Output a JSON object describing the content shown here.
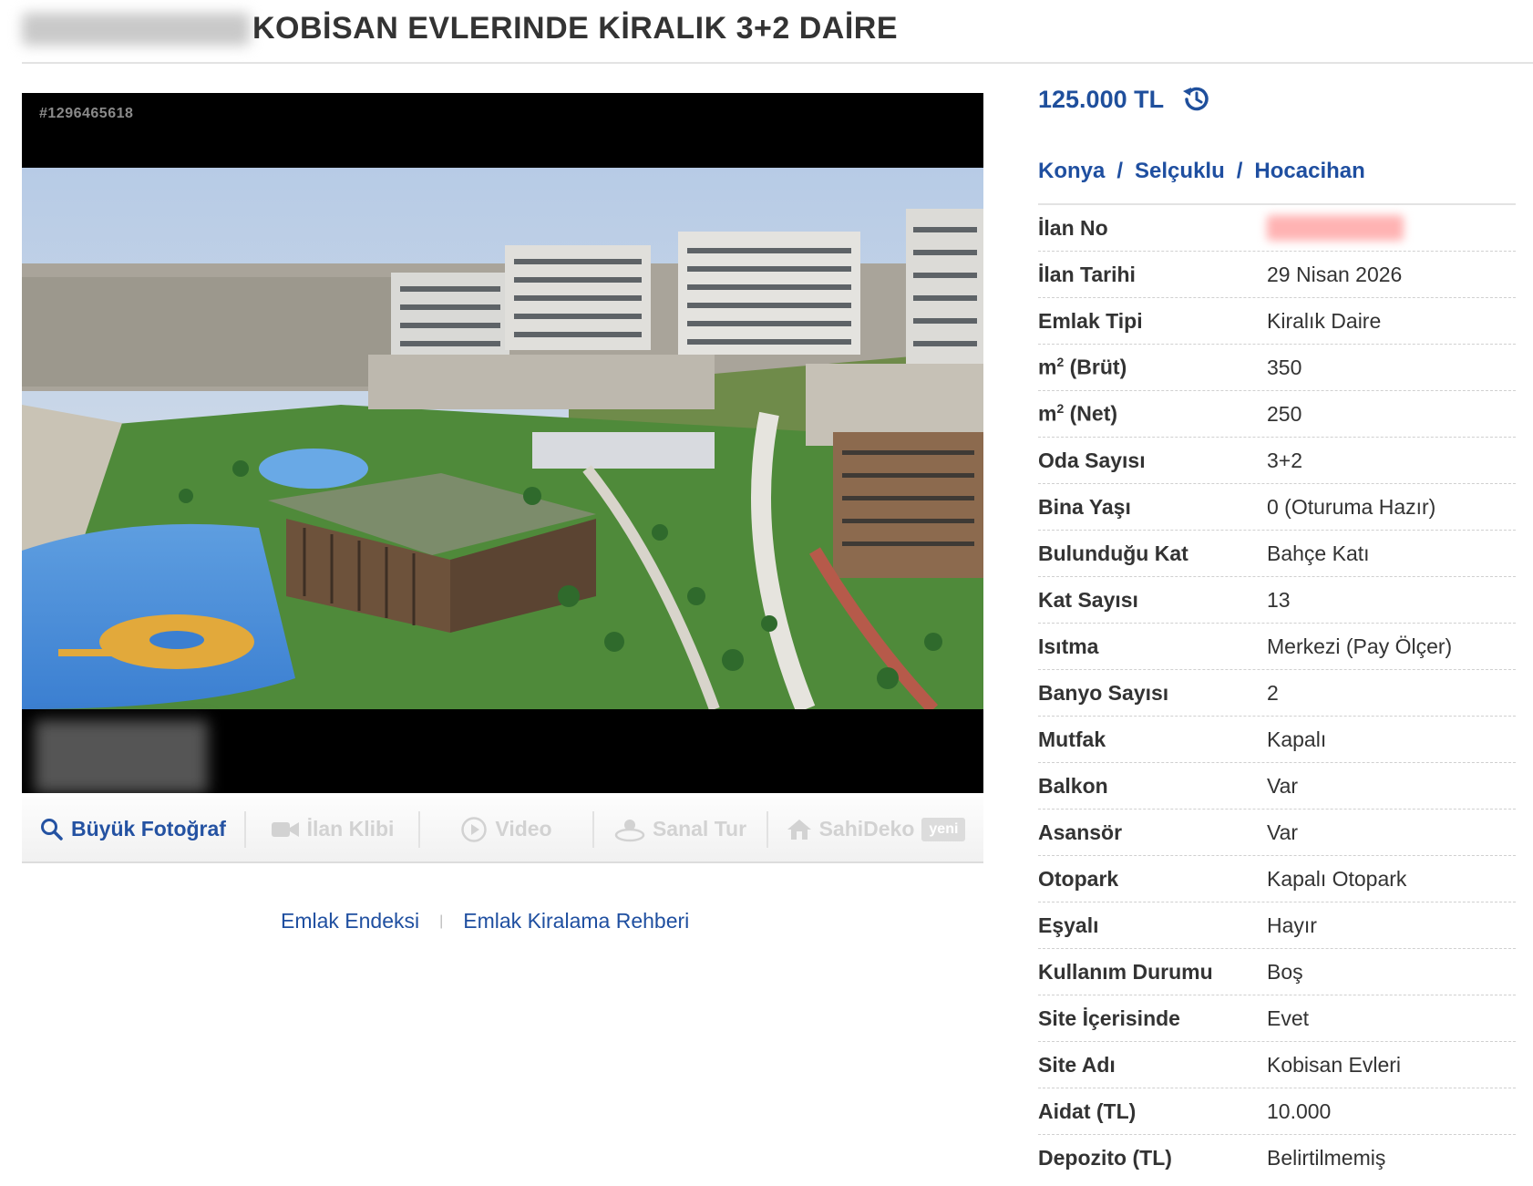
{
  "header": {
    "title": "KOBİSAN EVLERINDE KİRALIK 3+2 DAİRE"
  },
  "photo": {
    "id_overlay": "#1296465618"
  },
  "photo_tabs": [
    {
      "label": "Büyük Fotoğraf",
      "icon": "search-icon",
      "active": true
    },
    {
      "label": "İlan Klibi",
      "icon": "video-camera-icon",
      "active": false
    },
    {
      "label": "Video",
      "icon": "play-circle-icon",
      "active": false
    },
    {
      "label": "Sanal Tur",
      "icon": "360-view-icon",
      "active": false
    },
    {
      "label": "SahiDeko",
      "icon": "home-icon",
      "active": false,
      "badge": "yeni"
    }
  ],
  "links": {
    "index": "Emlak Endeksi",
    "separator": "|",
    "guide": "Emlak Kiralama Rehberi"
  },
  "price": {
    "value": "125.000 TL",
    "icon": "history-icon"
  },
  "location": {
    "city": "Konya",
    "district": "Selçuklu",
    "neighborhood": "Hocacihan",
    "separator": "/"
  },
  "details": [
    {
      "label": "İlan No",
      "value": ""
    },
    {
      "label": "İlan Tarihi",
      "value": "29 Nisan 2026"
    },
    {
      "label": "Emlak Tipi",
      "value": "Kiralık Daire"
    },
    {
      "label_main": "m",
      "label_sup": "2",
      "label_rest": " (Brüt)",
      "value": "350"
    },
    {
      "label_main": "m",
      "label_sup": "2",
      "label_rest": " (Net)",
      "value": "250"
    },
    {
      "label": "Oda Sayısı",
      "value": "3+2"
    },
    {
      "label": "Bina Yaşı",
      "value": "0 (Oturuma Hazır)"
    },
    {
      "label": "Bulunduğu Kat",
      "value": "Bahçe Katı"
    },
    {
      "label": "Kat Sayısı",
      "value": "13"
    },
    {
      "label": "Isıtma",
      "value": "Merkezi (Pay Ölçer)"
    },
    {
      "label": "Banyo Sayısı",
      "value": "2"
    },
    {
      "label": "Mutfak",
      "value": "Kapalı"
    },
    {
      "label": "Balkon",
      "value": "Var"
    },
    {
      "label": "Asansör",
      "value": "Var"
    },
    {
      "label": "Otopark",
      "value": "Kapalı Otopark"
    },
    {
      "label": "Eşyalı",
      "value": "Hayır"
    },
    {
      "label": "Kullanım Durumu",
      "value": "Boş"
    },
    {
      "label": "Site İçerisinde",
      "value": "Evet"
    },
    {
      "label": "Site Adı",
      "value": "Kobisan Evleri"
    },
    {
      "label": "Aidat (TL)",
      "value": "10.000"
    },
    {
      "label": "Depozito (TL)",
      "value": "Belirtilmemiş"
    }
  ],
  "colors": {
    "link_blue": "#1f4fa0",
    "price_blue": "#1f4f9c",
    "text": "#333333",
    "disabled_tab": "#d2d2d2"
  }
}
